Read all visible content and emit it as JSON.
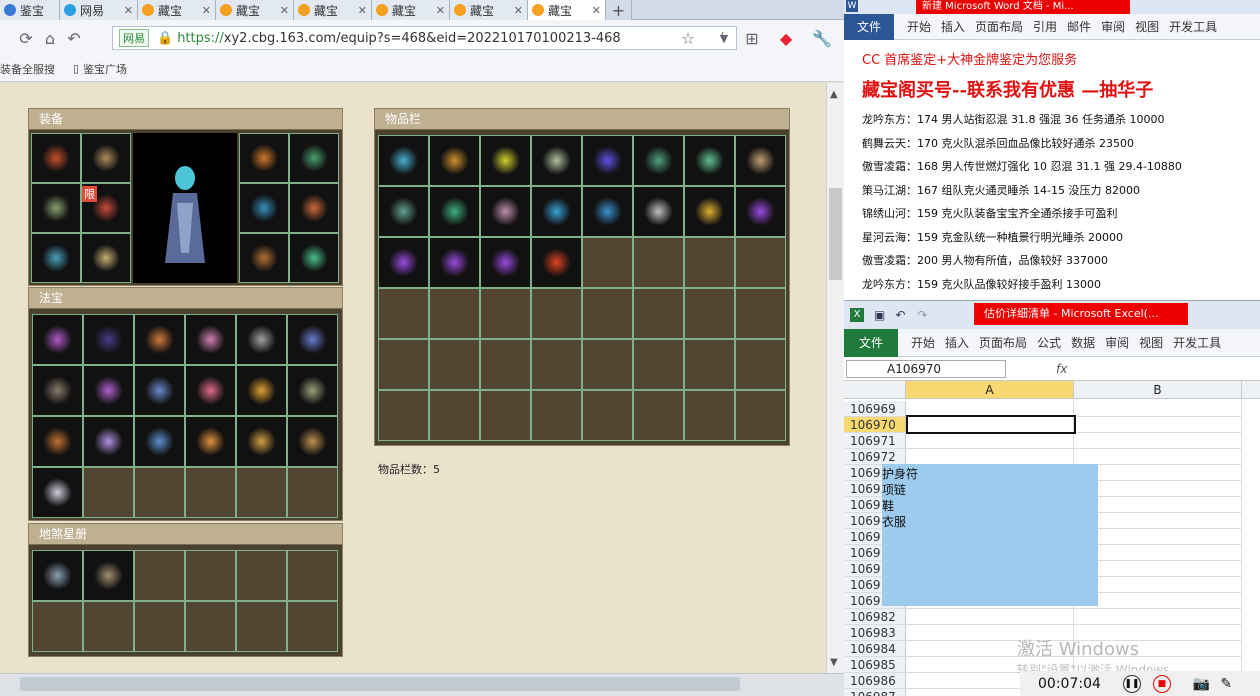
{
  "browser": {
    "tabs": [
      {
        "label": "鉴宝",
        "icon": "ie-icon"
      },
      {
        "label": "网易",
        "icon": "chrome-icon"
      },
      {
        "label": "藏宝",
        "icon": "cbg-icon"
      },
      {
        "label": "藏宝",
        "icon": "cbg-icon"
      },
      {
        "label": "藏宝",
        "icon": "cbg-icon"
      },
      {
        "label": "藏宝",
        "icon": "cbg-icon"
      },
      {
        "label": "藏宝",
        "icon": "cbg-icon"
      },
      {
        "label": "藏宝",
        "icon": "cbg-icon"
      }
    ],
    "url_site": "网易",
    "url_prefix": "https://",
    "url_rest": "xy2.cbg.163.com/equip?s=468&eid=202210170100213-468",
    "bookmarks": [
      "装备全服搜",
      "鉴宝广场"
    ]
  },
  "game": {
    "equip_title": "装备",
    "equip_badge": "限",
    "fabao_title": "法宝",
    "stars_title": "地煞星册",
    "inventory_title": "物品栏",
    "inventory_count": "物品栏数：5"
  },
  "word": {
    "title": "新建 Microsoft Word 文档 - Mi...",
    "file": "文件",
    "ribbon": [
      "开始",
      "插入",
      "页面布局",
      "引用",
      "邮件",
      "审阅",
      "视图",
      "开发工具"
    ],
    "head1": "CC 首席鉴定+大神金牌鉴定为您服务",
    "head2": "藏宝阁买号--联系我有优惠 —抽华子",
    "lines": [
      "龙吟东方：174 男人站街忍混 31.8 强混 36 任务通杀 10000",
      "鹤舞云天：170 克火队混杀回血品像比较好通杀 23500",
      "傲雪凌霜：168 男人传世燃灯强化 10 忍混 31.1 强 29.4-10880",
      "策马江湖：167 组队克火通灵睡杀 14-15 没压力 82000",
      "锦绣山河：159 克火队装备宝宝齐全通杀接手可盈利",
      "星河云海：159 克金队统一种植景行明光睡杀 20000",
      "傲雪凌霜：200 男人物有所值，品像较好 337000",
      "龙吟东方：159 克火队品像较好接手盈利 13000"
    ]
  },
  "excel": {
    "title": "估价详细清单 - Microsoft Excel(...",
    "file": "文件",
    "ribbon": [
      "开始",
      "插入",
      "页面布局",
      "公式",
      "数据",
      "审阅",
      "视图",
      "开发工具"
    ],
    "namebox": "A106970",
    "fx": "fx",
    "col_a": "A",
    "col_b": "B",
    "rows": [
      "106969",
      "106970",
      "106971",
      "106972",
      "1069",
      "1069",
      "1069",
      "1069",
      "1069",
      "1069",
      "1069",
      "1069",
      "1069",
      "106982",
      "106983",
      "106984",
      "106985",
      "106986",
      "106987"
    ],
    "pasted": [
      "护身符",
      "项链",
      "鞋",
      "衣服"
    ],
    "watermark1": "激活 Windows",
    "watermark2": "转到\"设置\"以激活 Windows。",
    "timer": "00:07:04"
  }
}
